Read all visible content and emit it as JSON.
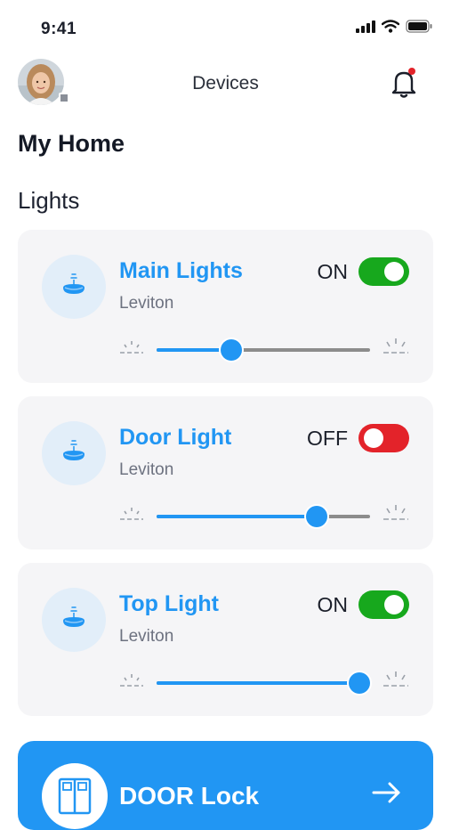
{
  "status_bar": {
    "time": "9:41"
  },
  "header": {
    "title": "Devices",
    "has_notification": true
  },
  "page": {
    "title": "My Home",
    "section": "Lights"
  },
  "colors": {
    "accent": "#2196f3",
    "on": "#17a81d",
    "off": "#e3232a",
    "card_bg": "#f5f5f7"
  },
  "lights": [
    {
      "name": "Main Lights",
      "brand": "Leviton",
      "status": "ON",
      "on": true,
      "brightness": 0.35
    },
    {
      "name": "Door Light",
      "brand": "Leviton",
      "status": "OFF",
      "on": false,
      "brightness": 0.75
    },
    {
      "name": "Top Light",
      "brand": "Leviton",
      "status": "ON",
      "on": true,
      "brightness": 0.95
    }
  ],
  "lock": {
    "title": "DOOR Lock",
    "icon": "door-icon",
    "action_icon": "arrow-right-icon"
  }
}
